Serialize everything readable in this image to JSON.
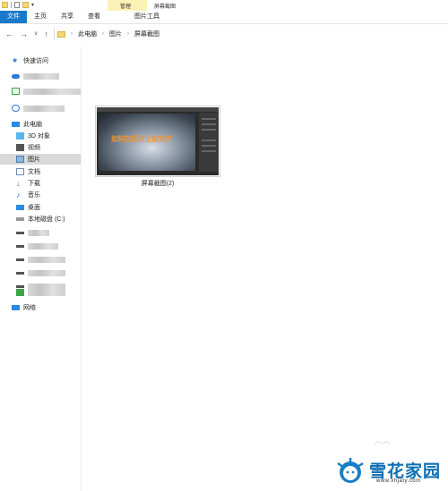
{
  "titlebar": {
    "context_group": "管理",
    "window_title": "屏幕截图"
  },
  "ribbon": {
    "tabs": [
      {
        "label": "文件"
      },
      {
        "label": "主页"
      },
      {
        "label": "共享"
      },
      {
        "label": "查看"
      },
      {
        "label": "图片工具"
      }
    ]
  },
  "address": {
    "crumbs": [
      "此电脑",
      "图片",
      "屏幕截图"
    ]
  },
  "sidebar": {
    "quick_access": "快速访问",
    "this_pc": "此电脑",
    "objects3d": "3D 对象",
    "videos": "视频",
    "pictures": "图片",
    "documents": "文档",
    "downloads": "下载",
    "music": "音乐",
    "desktop": "桌面",
    "local_disk": "本地磁盘 (C:)",
    "network": "网络"
  },
  "files": [
    {
      "name": "屏幕截图(2)",
      "thumb_overlay": "如何在照片上加文字"
    }
  ],
  "watermark": {
    "brand": "雪花家园",
    "url": "www.xhjaty.com"
  },
  "colors": {
    "accent": "#1979ca",
    "context_tab": "#fcf1b6",
    "selected": "#d9d9d9",
    "brand": "#0e6fb5"
  }
}
